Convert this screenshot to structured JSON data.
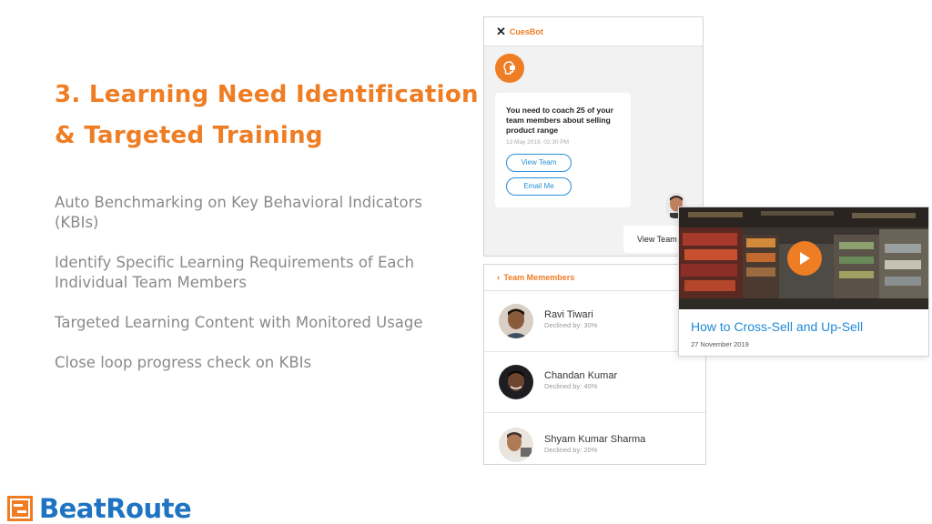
{
  "slide": {
    "title_line1": "3. Learning Need Identification",
    "title_line2": "& Targeted Training",
    "bullets": [
      "Auto Benchmarking on Key Behavioral Indicators (KBIs)",
      "Identify Specific Learning Requirements of Each Individual Team Members",
      "Targeted Learning Content with Monitored Usage",
      "Close loop progress check on KBIs"
    ]
  },
  "brand": {
    "name": "BeatRoute",
    "accent_orange": "#ee7d24",
    "accent_blue": "#1e73c2"
  },
  "chatbot": {
    "close_icon": "close-icon",
    "title": "CuesBot",
    "message": "You need to coach 25 of your team members about selling product range",
    "timestamp": "13 May 2019, 02:30 PM",
    "buttons": [
      "View Team",
      "Email Me"
    ],
    "user_reply": "View Team"
  },
  "team": {
    "title": "Team Memembers",
    "members": [
      {
        "name": "Ravi Tiwari",
        "detail": "Declined by: 30%"
      },
      {
        "name": "Chandan Kumar",
        "detail": "Declined by: 40%"
      },
      {
        "name": "Shyam Kumar Sharma",
        "detail": "Declined by: 20%"
      }
    ]
  },
  "video": {
    "title": "How to Cross-Sell and Up-Sell",
    "date": "27 November 2019",
    "play_icon": "play-icon"
  }
}
